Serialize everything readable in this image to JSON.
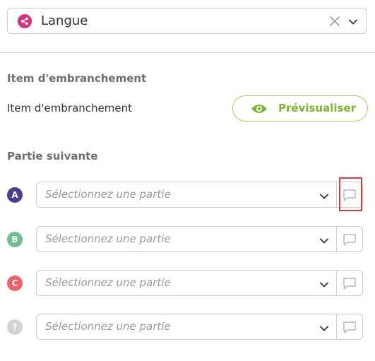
{
  "header": {
    "type_icon": "branch-icon",
    "type_icon_color": "#d9317a",
    "selected_value": "Langue"
  },
  "branch_section": {
    "title": "Item d'embranchement",
    "label": "Item d'embranchement",
    "preview_button": "Prévisualiser",
    "accent_color": "#7cb82f"
  },
  "next_section": {
    "title": "Partie suivante",
    "rows": [
      {
        "badge": "A",
        "color": "#4a3f8f",
        "placeholder": "Sélectionnez une partie"
      },
      {
        "badge": "B",
        "color": "#6fbf8a",
        "placeholder": "Sélectionnez une partie"
      },
      {
        "badge": "C",
        "color": "#f0616a",
        "placeholder": "Sélectionnez une partie"
      },
      {
        "badge": "?",
        "color": "#d3d3d3",
        "placeholder": "Sélectionnez une partie"
      }
    ]
  },
  "highlight_color": "#e53935"
}
